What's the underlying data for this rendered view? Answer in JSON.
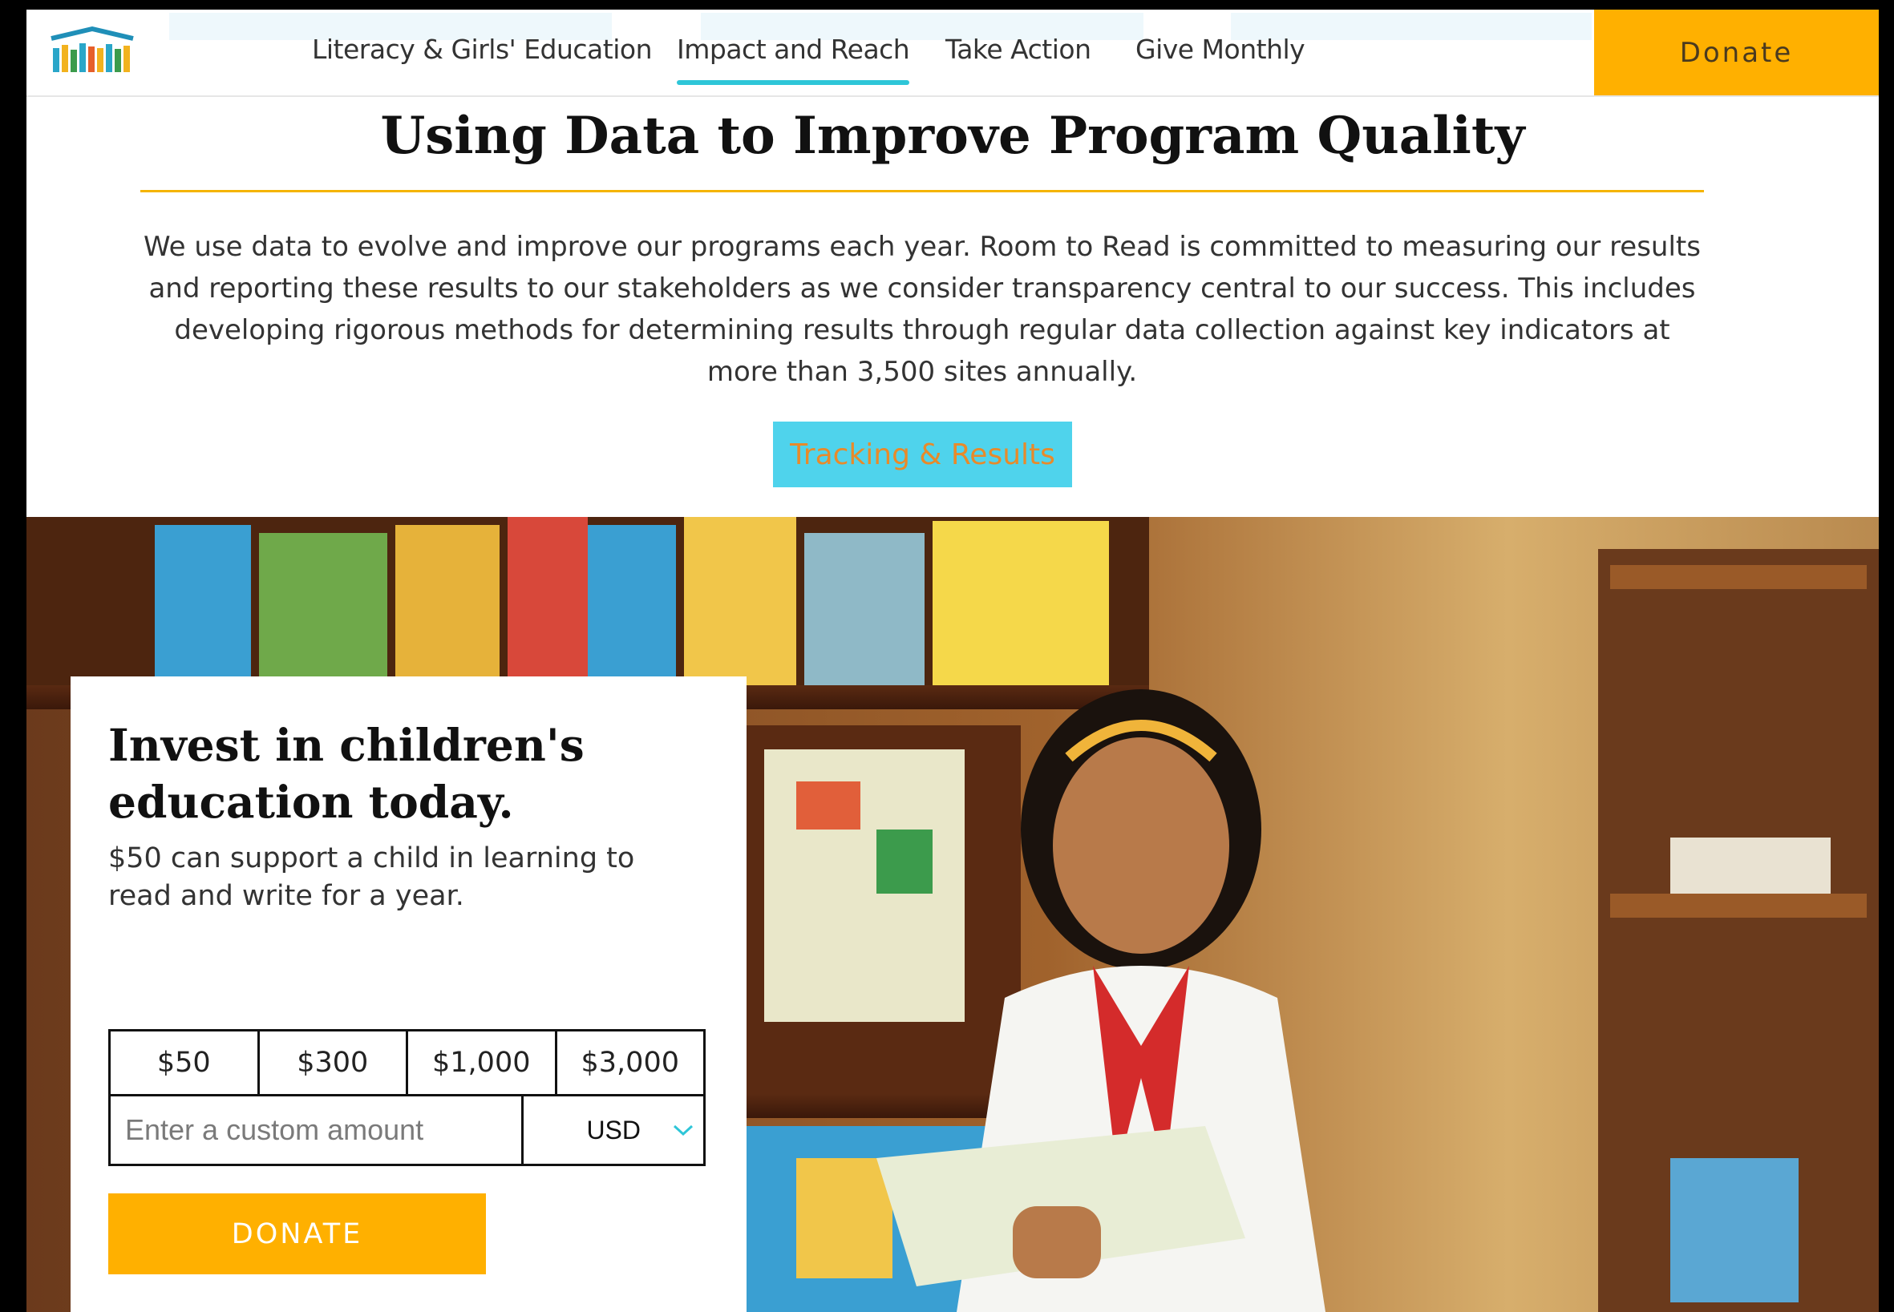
{
  "header": {
    "nav": [
      {
        "label": "Literacy & Girls' Education"
      },
      {
        "label": "Impact and Reach",
        "active": true
      },
      {
        "label": "Take Action"
      },
      {
        "label": "Give Monthly"
      }
    ],
    "donate_label": "Donate"
  },
  "intro": {
    "title": "Using Data to Improve Program Quality",
    "body": "We use data to evolve and improve our programs each year. Room to Read is committed to measuring our results and reporting these results to our stakeholders as we consider transparency central to our success. This includes developing rigorous methods for determining results through regular data collection against key indicators at more than 3,500 sites annually.",
    "cta_label": "Tracking & Results"
  },
  "donate_card": {
    "title": "Invest in children's education today.",
    "subtitle": "$50 can support a child in learning to read and write for a year.",
    "amounts": [
      "$50",
      "$300",
      "$1,000",
      "$3,000"
    ],
    "custom_placeholder": "Enter a custom amount",
    "currency": "USD",
    "donate_label": "DONATE"
  },
  "colors": {
    "accent_gold": "#ffb000",
    "accent_cyan": "#4fd3ec",
    "nav_underline": "#2ec6d8"
  },
  "icons": {
    "logo": "books-logo-icon",
    "currency_dropdown": "chevron-down-icon"
  }
}
